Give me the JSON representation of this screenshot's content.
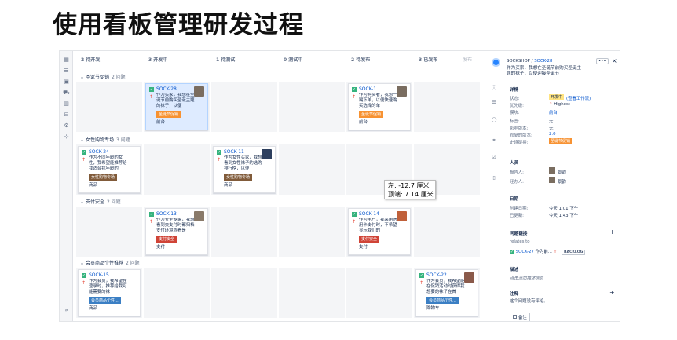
{
  "title": "使用看板管理研发过程",
  "board": {
    "columns": [
      {
        "count": "2",
        "name": "待开发"
      },
      {
        "count": "3",
        "name": "开发中"
      },
      {
        "count": "1",
        "name": "待测试"
      },
      {
        "count": "0",
        "name": "测试中"
      },
      {
        "count": "2",
        "name": "待发布"
      },
      {
        "count": "3",
        "name": "已发布"
      }
    ],
    "column_extra": "发布",
    "swimlanes": [
      {
        "name": "圣诞节促销",
        "count": "2 问题"
      },
      {
        "name": "女性购物专场",
        "count": "3 问题"
      },
      {
        "name": "支付安全",
        "count": "2 问题"
      },
      {
        "name": "会员商品个性推荐",
        "count": "2 问题"
      }
    ],
    "cards": [
      {
        "key": "SOCK-28",
        "summary": "作为买家，我想在圣诞节前购买圣诞主题的袜子，以便",
        "epic": "圣诞节促销",
        "epic_color": "#f79232",
        "component": "前台"
      },
      {
        "key": "SOCK-1",
        "summary": "作为购买者，我想一键下单，以便快速购买选择的单",
        "epic": "圣诞节促销",
        "epic_color": "#f79232",
        "component": "前台"
      },
      {
        "key": "SOCK-24",
        "summary": "作为不同年龄的女性，我希望能推荐给我适合我年龄的",
        "epic": "女性购物专场",
        "epic_color": "#815b3a",
        "component": "商品"
      },
      {
        "key": "SOCK-11",
        "summary": "作为女性买家，我想看到女性袜子的选购排行榜，以便",
        "epic": "女性购物专场",
        "epic_color": "#815b3a",
        "component": "商品"
      },
      {
        "key": "SOCK-13",
        "summary": "作为安全专家，我想看到交支付时都归档支付环境查看是",
        "epic": "支付安全",
        "epic_color": "#d04437",
        "component": "支付"
      },
      {
        "key": "SOCK-14",
        "summary": "作为用户，我采用信用卡支付时，不希望显示我们的",
        "epic": "支付安全",
        "epic_color": "#d04437",
        "component": "支付"
      },
      {
        "key": "SOCK-15",
        "summary": "作为会员，我希望在登录时，推荐给我可能需要的袜",
        "epic": "会员商品个性...",
        "epic_color": "#3b7fc4",
        "component": "商品"
      },
      {
        "key": "SOCK-22",
        "summary": "作为会员，我希望能在促销活动时获得我想要的袜子在首",
        "epic": "会员商品个性...",
        "epic_color": "#3b7fc4",
        "component": "购物车"
      }
    ]
  },
  "detail": {
    "breadcrumb_project": "SOCKSHOP",
    "breadcrumb_sep": " / ",
    "issue_key": "SOCK-28",
    "more_label": "•••",
    "close_label": "×",
    "summary": "作为买家，我想在圣诞节前购买圣诞主题的袜子，以便迎接圣诞节",
    "details_heading": "详情",
    "fields": [
      {
        "label": "状态:",
        "value": "开发中"
      },
      {
        "label": "优先级:",
        "value": "Highest"
      },
      {
        "label": "模块:",
        "value": "前台"
      },
      {
        "label": "标签:",
        "value": "无"
      },
      {
        "label": "影响版本:",
        "value": "无"
      },
      {
        "label": "修复的版本:",
        "value": "2.0"
      },
      {
        "label": "史诗链接:",
        "value": "圣诞节促销"
      }
    ],
    "status_extra": "(查看工作流)",
    "people_heading": "人员",
    "reporter_label": "报告人:",
    "reporter": "景韵",
    "assignee_label": "经办人:",
    "assignee": "景韵",
    "dates_heading": "日期",
    "created_label": "创建日期:",
    "created": "今天 1:01 下午",
    "updated_label": "已更新:",
    "updated": "今天 1:43 下午",
    "links_heading": "问题链接",
    "relates_to": "relates to",
    "linked_key": "SOCK-27",
    "linked_summary": "作为前...",
    "linked_status": "BACKLOG",
    "desc_heading": "描述",
    "desc_placeholder": "点击添加描述信息",
    "comments_heading": "注释",
    "no_comments": "这个问题没有评论。",
    "comment_button": "备注"
  },
  "tooltip": {
    "line1": "左: -12.7 厘米",
    "line2": "顶端: 7.14 厘米"
  },
  "colors": {
    "status_badge": "#ffe380",
    "link": "#0052cc",
    "story_icon": "#36b37e",
    "priority": "#e5493a"
  }
}
